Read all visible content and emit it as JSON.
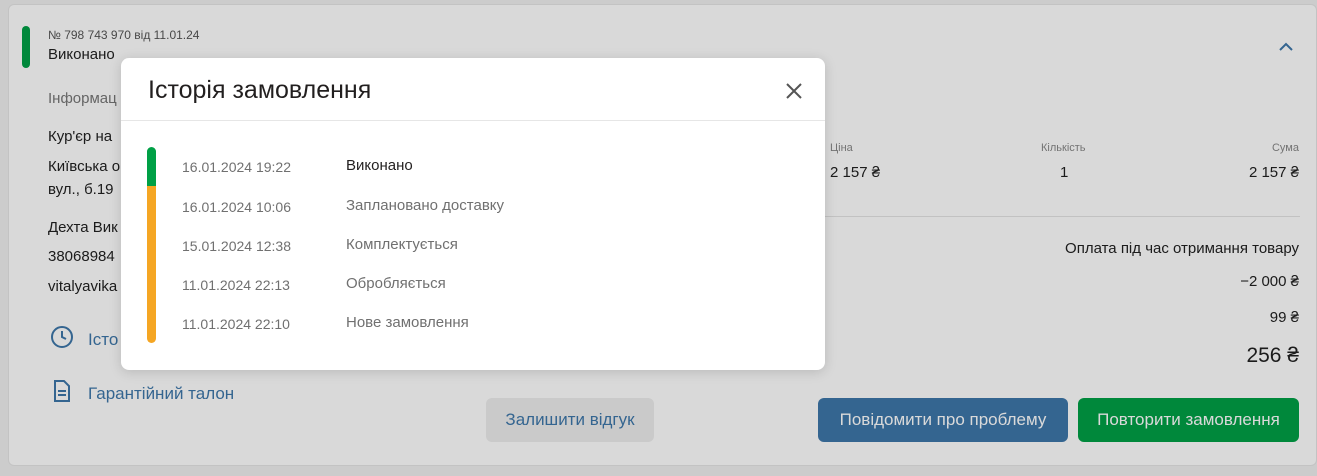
{
  "order": {
    "number_line": "№ 798 743 970 від 11.01.24",
    "status": "Виконано",
    "info_title": "Інформац",
    "courier": "Кур'єр на",
    "address_line1": "Київська о",
    "address_line2": "вул., б.19",
    "recipient": "Дехта Вик",
    "phone": "38068984",
    "email": "vitalyavika"
  },
  "table": {
    "price_header": "Ціна",
    "qty_header": "Кількість",
    "sum_header": "Сума",
    "price_value": "2 157 ₴",
    "qty_value": "1",
    "sum_value": "2 157 ₴"
  },
  "payment": {
    "method": "Оплата під час отримання товару",
    "discount": "−2 000 ₴",
    "delivery": "99 ₴",
    "total": "256 ₴"
  },
  "links": {
    "history": "Істо",
    "warranty": "Гарантійний талон"
  },
  "buttons": {
    "review": "Залишити відгук",
    "report_problem": "Повідомити про проблему",
    "repeat_order": "Повторити замовлення"
  },
  "modal": {
    "title": "Історія замовлення",
    "history": [
      {
        "date": "16.01.2024 19:22",
        "status": "Виконано"
      },
      {
        "date": "16.01.2024 10:06",
        "status": "Заплановано доставку"
      },
      {
        "date": "15.01.2024 12:38",
        "status": "Комплектується"
      },
      {
        "date": "11.01.2024 22:13",
        "status": "Обробляється"
      },
      {
        "date": "11.01.2024 22:10",
        "status": "Нове замовлення"
      }
    ]
  },
  "colors": {
    "green": "#00a046",
    "blue": "#3e77aa",
    "yellow": "#f5a623"
  },
  "icons": {
    "history": "clock-icon",
    "warranty": "document-icon",
    "close": "close-icon",
    "collapse": "chevron-up-icon"
  }
}
